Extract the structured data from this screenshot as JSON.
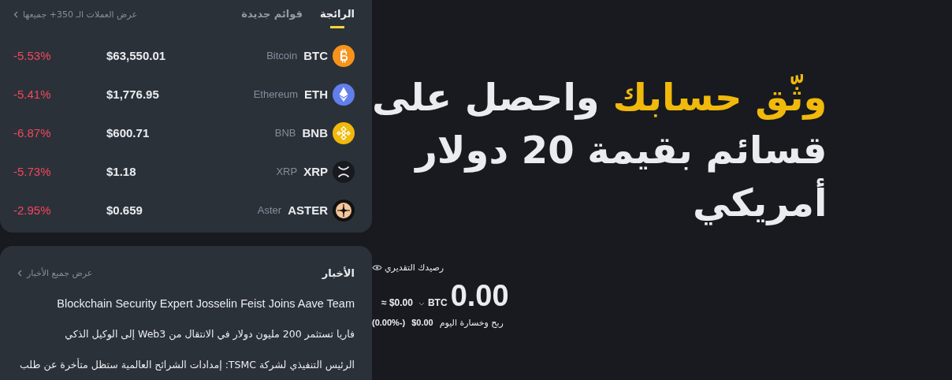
{
  "markets": {
    "tabs": [
      {
        "label": "الرائجة",
        "selected": true
      },
      {
        "label": "قوائم جديدة",
        "selected": false
      }
    ],
    "view_all": "عرض العملات الـ 350+ جميعها",
    "coins": [
      {
        "symbol": "BTC",
        "name": "Bitcoin",
        "price": "$63,550.01",
        "change": "-5.53%",
        "kind": "btc"
      },
      {
        "symbol": "ETH",
        "name": "Ethereum",
        "price": "$1,776.95",
        "change": "-5.41%",
        "kind": "eth"
      },
      {
        "symbol": "BNB",
        "name": "BNB",
        "price": "$600.71",
        "change": "-6.87%",
        "kind": "bnb"
      },
      {
        "symbol": "XRP",
        "name": "XRP",
        "price": "$1.18",
        "change": "-5.73%",
        "kind": "xrp"
      },
      {
        "symbol": "ASTER",
        "name": "Aster",
        "price": "$0.659",
        "change": "-2.95%",
        "kind": "aster"
      }
    ]
  },
  "news": {
    "title": "الأخبار",
    "view_all": "عرض جميع الأخبار",
    "items": [
      "Blockchain Security Expert Josselin Feist Joins Aave Team",
      "فاريا تستثمر 200 مليون دولار في الانتقال من Web3 إلى الوكيل الذكي",
      "الرئيس التنفيذي لشركة TSMC: إمدادات الشرائح العالمية ستظل متأخرة عن طلب"
    ]
  },
  "hero": {
    "highlight": "وثّق حسابك",
    "lines": [
      "واحصل على",
      "قسائم بقيمة 20 دولار",
      "أمريكي"
    ]
  },
  "balance": {
    "label": "رصيدك التقديري",
    "amount": "0.00",
    "currency": "BTC",
    "approx": "≈ $0.00",
    "pnl_label": "ربح وخسارة اليوم",
    "pnl_value": "$0.00",
    "pnl_change": "(-0.00%)"
  }
}
